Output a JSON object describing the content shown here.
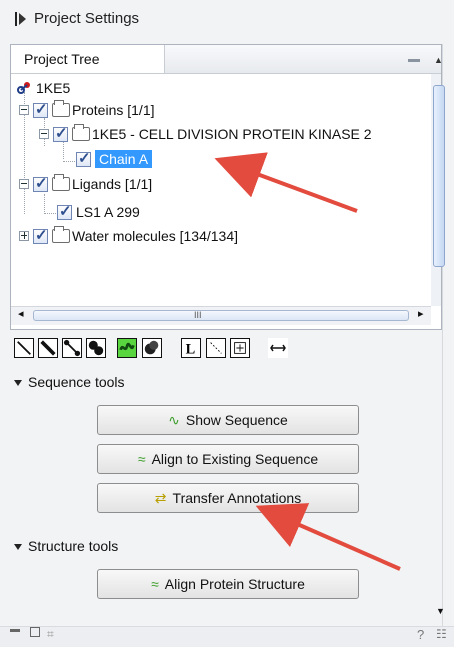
{
  "window": {
    "title": "Project Settings"
  },
  "tabs": {
    "project_tree": "Project Tree"
  },
  "tree": {
    "root": "1KE5",
    "proteins": "Proteins [1/1]",
    "protein_item": "1KE5 - CELL DIVISION PROTEIN KINASE 2",
    "chain": "Chain A",
    "ligands": "Ligands [1/1]",
    "ligand_item": "LS1 A 299",
    "water": "Water molecules [134/134]"
  },
  "hscroll": {
    "grip": "III"
  },
  "sections": {
    "sequence_tools": "Sequence tools",
    "structure_tools": "Structure tools"
  },
  "buttons": {
    "show_sequence": "Show Sequence",
    "align_existing": "Align to Existing Sequence",
    "transfer_annotations": "Transfer Annotations",
    "align_structure": "Align Protein Structure"
  },
  "bottombar": {
    "help": "?"
  },
  "icons": {
    "header": "play-arrow-icon",
    "scroll_up": "scroll-up-icon"
  }
}
